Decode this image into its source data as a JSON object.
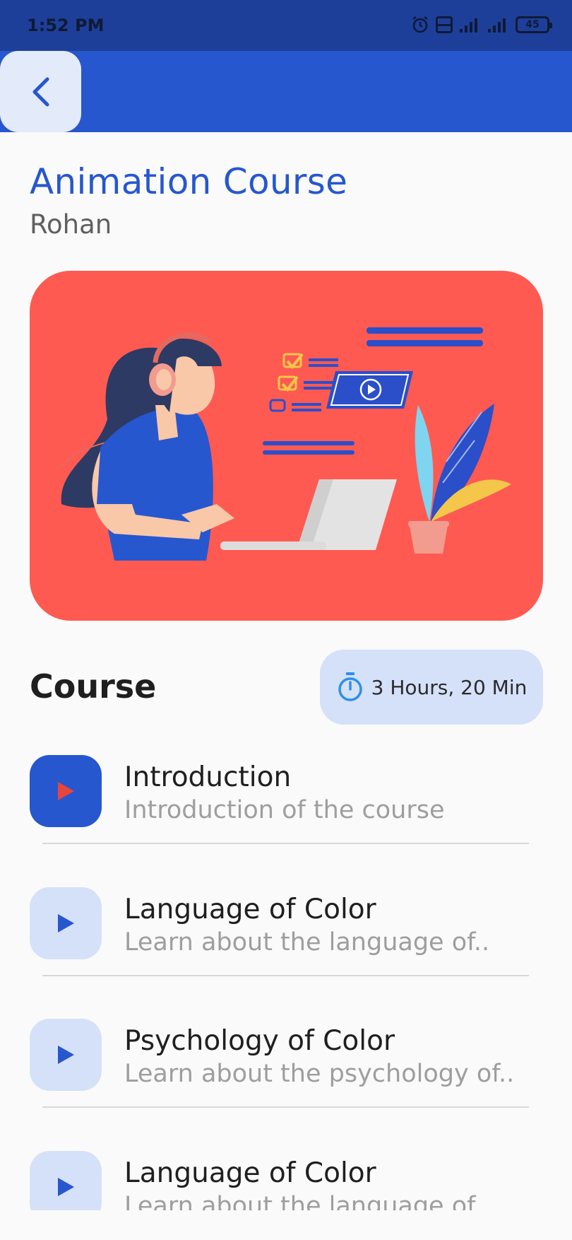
{
  "status_bar": {
    "time": "1:52 PM",
    "battery": "45",
    "icons": [
      "alarm-icon",
      "volte-icon",
      "signal-icon",
      "signal-icon",
      "battery-icon"
    ]
  },
  "app_bar": {
    "back_icon": "chevron-left-icon"
  },
  "course": {
    "title": "Animation Course",
    "author": "Rohan"
  },
  "section": {
    "title": "Course",
    "duration": "3 Hours, 20 Min",
    "duration_icon": "stopwatch-icon"
  },
  "lessons": [
    {
      "title": "Introduction",
      "subtitle": "Introduction of the course",
      "active": true
    },
    {
      "title": "Language of Color",
      "subtitle": "Learn about the language of..",
      "active": false
    },
    {
      "title": "Psychology of Color",
      "subtitle": "Learn about the psychology of..",
      "active": false
    },
    {
      "title": "Language of Color",
      "subtitle": "Learn about the language of..",
      "active": false
    }
  ],
  "colors": {
    "primary": "#2757cf",
    "status_bar": "#1e3f99",
    "hero_background": "#fe5a52",
    "chip_background": "#d5e1f8",
    "active_play": "#e8453c",
    "inactive_play": "#2757cf"
  }
}
